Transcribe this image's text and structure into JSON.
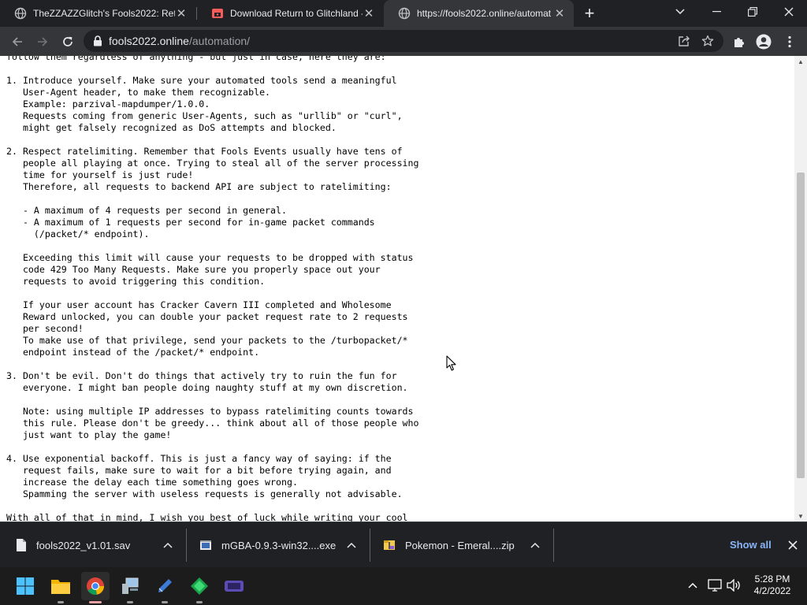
{
  "browser": {
    "tabs": [
      {
        "title": "TheZZAZZGlitch's Fools2022: Ret",
        "favicon": "globe-icon",
        "active": false
      },
      {
        "title": "Download Return to Glitchland -",
        "favicon": "itch-icon",
        "active": false
      },
      {
        "title": "https://fools2022.online/automat",
        "favicon": "globe-icon",
        "active": true
      }
    ],
    "address_bar": {
      "host": "fools2022.online",
      "path": "/automation/"
    }
  },
  "page": {
    "lines": [
      "follow them regardless of anything - but just in case, here they are:",
      "",
      "1. Introduce yourself. Make sure your automated tools send a meaningful",
      "   User-Agent header, to make them recognizable.",
      "   Example: parzival-mapdumper/1.0.0.",
      "   Requests coming from generic User-Agents, such as \"urllib\" or \"curl\",",
      "   might get falsely recognized as DoS attempts and blocked.",
      "",
      "2. Respect ratelimiting. Remember that Fools Events usually have tens of",
      "   people all playing at once. Trying to steal all of the server processing",
      "   time for yourself is just rude!",
      "   Therefore, all requests to backend API are subject to ratelimiting:",
      "",
      "   - A maximum of 4 requests per second in general.",
      "   - A maximum of 1 requests per second for in-game packet commands",
      "     (/packet/* endpoint).",
      "",
      "   Exceeding this limit will cause your requests to be dropped with status",
      "   code 429 Too Many Requests. Make sure you properly space out your",
      "   requests to avoid triggering this condition.",
      "",
      "   If your user account has Cracker Cavern III completed and Wholesome",
      "   Reward unlocked, you can double your packet request rate to 2 requests",
      "   per second!",
      "   To make use of that privilege, send your packets to the /turbopacket/*",
      "   endpoint instead of the /packet/* endpoint.",
      "",
      "3. Don't be evil. Don't do things that actively try to ruin the fun for",
      "   everyone. I might ban people doing naughty stuff at my own discretion.",
      "",
      "   Note: using multiple IP addresses to bypass ratelimiting counts towards",
      "   this rule. Please don't be greedy... think about all of those people who",
      "   just want to play the game!",
      "",
      "4. Use exponential backoff. This is just a fancy way of saying: if the",
      "   request fails, make sure to wait for a bit before trying again, and",
      "   increase the delay each time something goes wrong.",
      "   Spamming the server with useless requests is generally not advisable.",
      "",
      "With all of that in mind, I wish you best of luck while writing your cool"
    ]
  },
  "downloads": {
    "items": [
      {
        "name": "fools2022_v1.01.sav",
        "icon": "file-icon"
      },
      {
        "name": "mGBA-0.9.3-win32....exe",
        "icon": "installer-icon"
      },
      {
        "name": "Pokemon - Emeral....zip",
        "icon": "zip-icon"
      }
    ],
    "show_all": "Show all"
  },
  "taskbar": {
    "apps": [
      "start-icon",
      "file-explorer-icon",
      "chrome-icon",
      "pc-icon",
      "pen-icon",
      "emerald-icon",
      "game-icon"
    ],
    "time": "5:28 PM",
    "date": "4/2/2022"
  },
  "colors": {
    "accent_link": "#8ab4f8",
    "chrome_dark": "#202124",
    "chrome_toolbar": "#35363a"
  }
}
